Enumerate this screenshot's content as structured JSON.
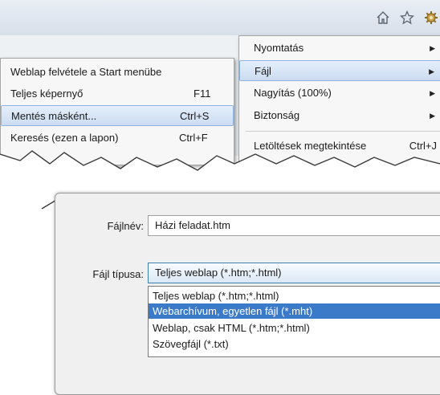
{
  "toolbar": {
    "icons": [
      "home-icon",
      "star-icon",
      "gear-icon"
    ]
  },
  "tools_menu": {
    "items": [
      {
        "label": "Nyomtatás",
        "has_submenu": true
      },
      {
        "label": "Fájl",
        "has_submenu": true,
        "highlighted": true
      },
      {
        "label": "Nagyítás (100%)",
        "has_submenu": true
      },
      {
        "label": "Biztonság",
        "has_submenu": true
      }
    ],
    "downloads": {
      "label": "Letöltések megtekintése",
      "shortcut": "Ctrl+J"
    }
  },
  "file_submenu": {
    "items": [
      {
        "label": "Weblap felvétele a Start menübe",
        "shortcut": ""
      },
      {
        "label": "Teljes képernyő",
        "shortcut": "F11"
      },
      {
        "label": "Mentés másként...",
        "shortcut": "Ctrl+S",
        "highlighted": true
      },
      {
        "label": "Keresés (ezen a lapon)",
        "shortcut": "Ctrl+F"
      }
    ]
  },
  "save_dialog": {
    "filename_label": "Fájlnév:",
    "filename_value": "Házi feladat.htm",
    "filetype_label": "Fájl típusa:",
    "filetype_value": "Teljes weblap (*.htm;*.html)",
    "filetype_options": [
      "Teljes weblap (*.htm;*.html)",
      "Webarchívum, egyetlen fájl (*.mht)",
      "Weblap, csak HTML (*.htm;*.html)",
      "Szövegfájl (*.txt)"
    ],
    "selected_option_index": 1
  },
  "colors": {
    "menu_highlight": "#cbdcf1",
    "list_selection": "#3b7ac9"
  }
}
